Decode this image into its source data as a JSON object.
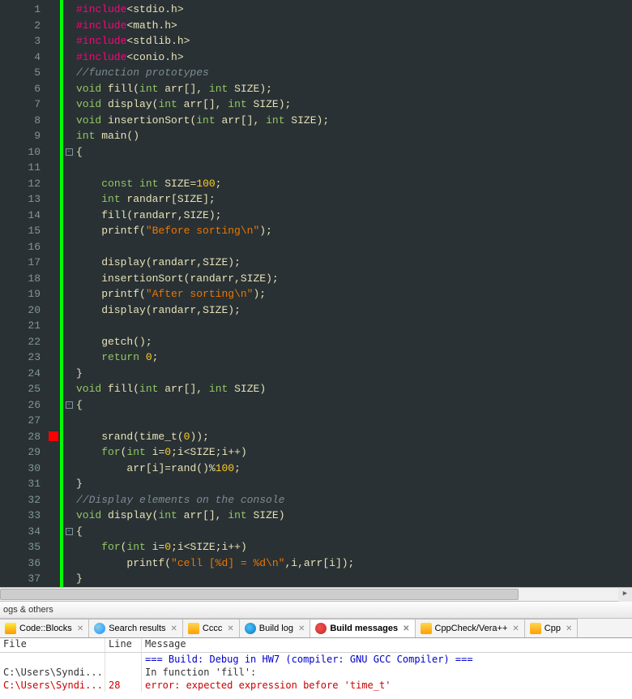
{
  "editor": {
    "line_count": 37,
    "breakpoint_line": 28,
    "fold_lines": [
      10,
      26,
      34
    ],
    "code": [
      [
        [
          "kw-inc",
          "#include"
        ],
        [
          "ident",
          "<stdio.h>"
        ]
      ],
      [
        [
          "kw-inc",
          "#include"
        ],
        [
          "ident",
          "<math.h>"
        ]
      ],
      [
        [
          "kw-inc",
          "#include"
        ],
        [
          "ident",
          "<stdlib.h>"
        ]
      ],
      [
        [
          "kw-inc",
          "#include"
        ],
        [
          "ident",
          "<conio.h>"
        ]
      ],
      [
        [
          "comment",
          "//function prototypes"
        ]
      ],
      [
        [
          "kw-type",
          "void"
        ],
        [
          "ident",
          " fill"
        ],
        [
          "punct",
          "("
        ],
        [
          "kw-type",
          "int"
        ],
        [
          "ident",
          " arr"
        ],
        [
          "punct",
          "[], "
        ],
        [
          "kw-type",
          "int"
        ],
        [
          "ident",
          " SIZE"
        ],
        [
          "punct",
          ");"
        ]
      ],
      [
        [
          "kw-type",
          "void"
        ],
        [
          "ident",
          " display"
        ],
        [
          "punct",
          "("
        ],
        [
          "kw-type",
          "int"
        ],
        [
          "ident",
          " arr"
        ],
        [
          "punct",
          "[], "
        ],
        [
          "kw-type",
          "int"
        ],
        [
          "ident",
          " SIZE"
        ],
        [
          "punct",
          ");"
        ]
      ],
      [
        [
          "kw-type",
          "void"
        ],
        [
          "ident",
          " insertionSort"
        ],
        [
          "punct",
          "("
        ],
        [
          "kw-type",
          "int"
        ],
        [
          "ident",
          " arr"
        ],
        [
          "punct",
          "[], "
        ],
        [
          "kw-type",
          "int"
        ],
        [
          "ident",
          " SIZE"
        ],
        [
          "punct",
          ");"
        ]
      ],
      [
        [
          "kw-type",
          "int"
        ],
        [
          "ident",
          " main"
        ],
        [
          "punct",
          "()"
        ]
      ],
      [
        [
          "punct",
          "{"
        ]
      ],
      [
        [
          "ident",
          ""
        ]
      ],
      [
        [
          "ident",
          "    "
        ],
        [
          "kw-type",
          "const int"
        ],
        [
          "ident",
          " SIZE"
        ],
        [
          "punct",
          "="
        ],
        [
          "num",
          "100"
        ],
        [
          "punct",
          ";"
        ]
      ],
      [
        [
          "ident",
          "    "
        ],
        [
          "kw-type",
          "int"
        ],
        [
          "ident",
          " randarr"
        ],
        [
          "punct",
          "["
        ],
        [
          "ident",
          "SIZE"
        ],
        [
          "punct",
          "];"
        ]
      ],
      [
        [
          "ident",
          "    fill"
        ],
        [
          "punct",
          "("
        ],
        [
          "ident",
          "randarr"
        ],
        [
          "punct",
          ","
        ],
        [
          "ident",
          "SIZE"
        ],
        [
          "punct",
          ");"
        ]
      ],
      [
        [
          "ident",
          "    printf"
        ],
        [
          "punct",
          "("
        ],
        [
          "str",
          "\"Before sorting\\n\""
        ],
        [
          "punct",
          ");"
        ]
      ],
      [
        [
          "ident",
          ""
        ]
      ],
      [
        [
          "ident",
          "    display"
        ],
        [
          "punct",
          "("
        ],
        [
          "ident",
          "randarr"
        ],
        [
          "punct",
          ","
        ],
        [
          "ident",
          "SIZE"
        ],
        [
          "punct",
          ");"
        ]
      ],
      [
        [
          "ident",
          "    insertionSort"
        ],
        [
          "punct",
          "("
        ],
        [
          "ident",
          "randarr"
        ],
        [
          "punct",
          ","
        ],
        [
          "ident",
          "SIZE"
        ],
        [
          "punct",
          ");"
        ]
      ],
      [
        [
          "ident",
          "    printf"
        ],
        [
          "punct",
          "("
        ],
        [
          "str",
          "\"After sorting\\n\""
        ],
        [
          "punct",
          ");"
        ]
      ],
      [
        [
          "ident",
          "    display"
        ],
        [
          "punct",
          "("
        ],
        [
          "ident",
          "randarr"
        ],
        [
          "punct",
          ","
        ],
        [
          "ident",
          "SIZE"
        ],
        [
          "punct",
          ");"
        ]
      ],
      [
        [
          "ident",
          ""
        ]
      ],
      [
        [
          "ident",
          "    getch"
        ],
        [
          "punct",
          "();"
        ]
      ],
      [
        [
          "ident",
          "    "
        ],
        [
          "kw-ret",
          "return"
        ],
        [
          "ident",
          " "
        ],
        [
          "num",
          "0"
        ],
        [
          "punct",
          ";"
        ]
      ],
      [
        [
          "punct",
          "}"
        ]
      ],
      [
        [
          "kw-type",
          "void"
        ],
        [
          "ident",
          " fill"
        ],
        [
          "punct",
          "("
        ],
        [
          "kw-type",
          "int"
        ],
        [
          "ident",
          " arr"
        ],
        [
          "punct",
          "[], "
        ],
        [
          "kw-type",
          "int"
        ],
        [
          "ident",
          " SIZE"
        ],
        [
          "punct",
          ")"
        ]
      ],
      [
        [
          "punct",
          "{"
        ]
      ],
      [
        [
          "ident",
          ""
        ]
      ],
      [
        [
          "ident",
          "    srand"
        ],
        [
          "punct",
          "("
        ],
        [
          "ident",
          "time_t"
        ],
        [
          "punct",
          "("
        ],
        [
          "num",
          "0"
        ],
        [
          "punct",
          "));"
        ]
      ],
      [
        [
          "ident",
          "    "
        ],
        [
          "kw-ret",
          "for"
        ],
        [
          "punct",
          "("
        ],
        [
          "kw-type",
          "int"
        ],
        [
          "ident",
          " i"
        ],
        [
          "punct",
          "="
        ],
        [
          "num",
          "0"
        ],
        [
          "punct",
          ";"
        ],
        [
          "ident",
          "i"
        ],
        [
          "punct",
          "<"
        ],
        [
          "ident",
          "SIZE"
        ],
        [
          "punct",
          ";"
        ],
        [
          "ident",
          "i"
        ],
        [
          "punct",
          "++)"
        ]
      ],
      [
        [
          "ident",
          "        arr"
        ],
        [
          "punct",
          "["
        ],
        [
          "ident",
          "i"
        ],
        [
          "punct",
          "]="
        ],
        [
          "ident",
          "rand"
        ],
        [
          "punct",
          "()%"
        ],
        [
          "num",
          "100"
        ],
        [
          "punct",
          ";"
        ]
      ],
      [
        [
          "punct",
          "}"
        ]
      ],
      [
        [
          "comment",
          "//Display elements on the console"
        ]
      ],
      [
        [
          "kw-type",
          "void"
        ],
        [
          "ident",
          " display"
        ],
        [
          "punct",
          "("
        ],
        [
          "kw-type",
          "int"
        ],
        [
          "ident",
          " arr"
        ],
        [
          "punct",
          "[], "
        ],
        [
          "kw-type",
          "int"
        ],
        [
          "ident",
          " SIZE"
        ],
        [
          "punct",
          ")"
        ]
      ],
      [
        [
          "punct",
          "{"
        ]
      ],
      [
        [
          "ident",
          "    "
        ],
        [
          "kw-ret",
          "for"
        ],
        [
          "punct",
          "("
        ],
        [
          "kw-type",
          "int"
        ],
        [
          "ident",
          " i"
        ],
        [
          "punct",
          "="
        ],
        [
          "num",
          "0"
        ],
        [
          "punct",
          ";"
        ],
        [
          "ident",
          "i"
        ],
        [
          "punct",
          "<"
        ],
        [
          "ident",
          "SIZE"
        ],
        [
          "punct",
          ";"
        ],
        [
          "ident",
          "i"
        ],
        [
          "punct",
          "++)"
        ]
      ],
      [
        [
          "ident",
          "        printf"
        ],
        [
          "punct",
          "("
        ],
        [
          "str",
          "\"cell [%d] = %d\\n\""
        ],
        [
          "punct",
          ","
        ],
        [
          "ident",
          "i"
        ],
        [
          "punct",
          ","
        ],
        [
          "ident",
          "arr"
        ],
        [
          "punct",
          "["
        ],
        [
          "ident",
          "i"
        ],
        [
          "punct",
          "]);"
        ]
      ],
      [
        [
          "punct",
          "}"
        ]
      ]
    ]
  },
  "panel": {
    "title": "ogs & others",
    "tabs": [
      {
        "label": "Code::Blocks",
        "icon": "icon-cb"
      },
      {
        "label": "Search results",
        "icon": "icon-search"
      },
      {
        "label": "Cccc",
        "icon": "icon-cccc"
      },
      {
        "label": "Build log",
        "icon": "icon-buildlog"
      },
      {
        "label": "Build messages",
        "icon": "icon-buildmsg",
        "active": true
      },
      {
        "label": "CppCheck/Vera++",
        "icon": "icon-cpp"
      },
      {
        "label": "Cpp",
        "icon": "icon-cpp"
      }
    ],
    "headers": {
      "file": "File",
      "line": "Line",
      "message": "Message"
    },
    "rows": [
      {
        "file": "",
        "line": "",
        "msg": "=== Build: Debug in HW7 (compiler: GNU GCC Compiler) ===",
        "cls": "blue"
      },
      {
        "file": "C:\\Users\\Syndi...",
        "line": "",
        "msg": "In function 'fill':",
        "cls": ""
      },
      {
        "file": "C:\\Users\\Syndi...",
        "line": "28",
        "msg": "error: expected expression before 'time_t'",
        "cls": "red"
      }
    ]
  }
}
